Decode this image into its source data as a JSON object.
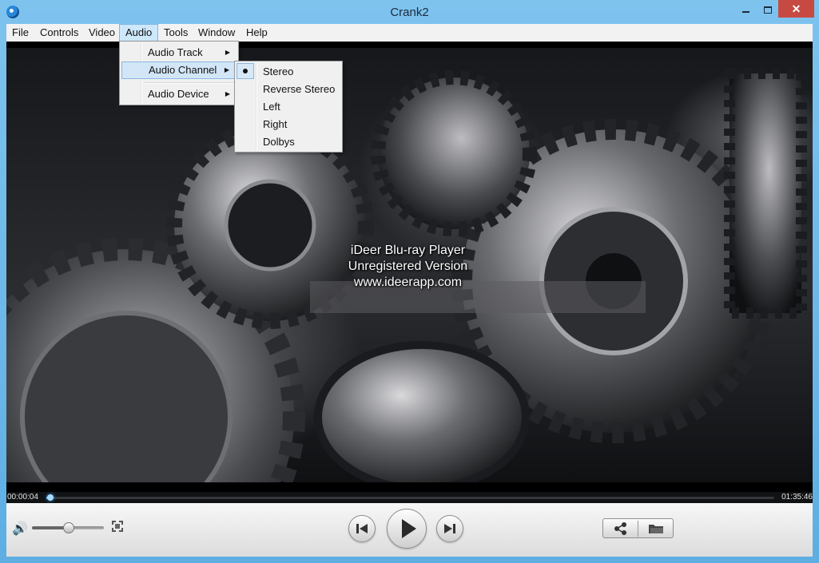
{
  "window": {
    "title": "Crank2",
    "controls": {
      "minimize_icon": "minimize-icon",
      "maximize_icon": "maximize-icon",
      "close_icon": "close-icon",
      "close_glyph": "✕"
    }
  },
  "menubar": {
    "items": [
      {
        "label": "File"
      },
      {
        "label": "Controls"
      },
      {
        "label": "Video"
      },
      {
        "label": "Audio",
        "active": true
      },
      {
        "label": "Tools"
      },
      {
        "label": "Window"
      },
      {
        "label": "Help"
      }
    ]
  },
  "audio_menu": {
    "items": [
      {
        "label": "Audio Track",
        "submenu": true
      },
      {
        "label": "Audio Channel",
        "submenu": true,
        "highlighted": true
      },
      {
        "label": "Audio Device",
        "submenu": true
      }
    ],
    "arrow_glyph": "▶"
  },
  "channel_menu": {
    "items": [
      {
        "label": "Stereo",
        "selected": true
      },
      {
        "label": "Reverse Stereo"
      },
      {
        "label": "Left"
      },
      {
        "label": "Right"
      },
      {
        "label": "Dolbys"
      }
    ]
  },
  "video": {
    "watermark": {
      "line1": "iDeer Blu-ray Player",
      "line2": "Unregistered Version",
      "line3": "www.ideerapp.com"
    }
  },
  "playback": {
    "elapsed": "00:00:04",
    "total": "01:35:46",
    "progress": 0.0007
  },
  "controls": {
    "volume_icon": "🔊",
    "volume_level": 0.5,
    "accent_color": "#6ec3ff"
  }
}
